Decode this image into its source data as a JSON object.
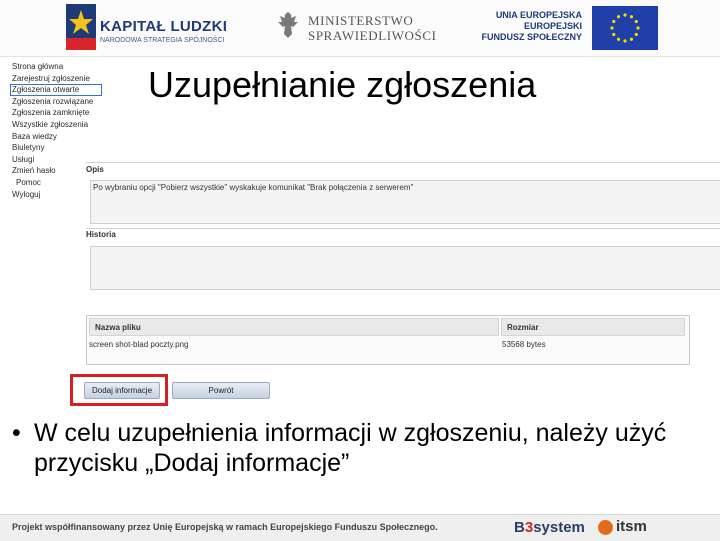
{
  "header": {
    "kapital_title": "KAPITAŁ LUDZKI",
    "kapital_sub": "NARODOWA STRATEGIA SPÓJNOŚCI",
    "ministry_line1": "MINISTERSTWO",
    "ministry_line2": "SPRAWIEDLIWOŚCI",
    "ue_line1": "UNIA EUROPEJSKA",
    "ue_line2": "EUROPEJSKI",
    "ue_line3": "FUNDUSZ SPOŁECZNY",
    "colors": {
      "kl_blue": "#1f3a78",
      "eu_blue": "#1e40a8",
      "eu_star": "#ffd400"
    }
  },
  "nav": {
    "items": [
      {
        "label": "Strona główna"
      },
      {
        "label": "Zarejestruj zgłoszenie"
      },
      {
        "label": "Zgłoszenia otwarte"
      },
      {
        "label": "Zgłoszenia rozwiązane"
      },
      {
        "label": "Zgłoszenia zamknięte"
      },
      {
        "label": "Wszystkie zgłoszenia"
      },
      {
        "label": "Baza wiedzy"
      },
      {
        "label": "Biuletyny"
      },
      {
        "label": "Usługi"
      },
      {
        "label": "Zmień hasło"
      },
      {
        "label": "Pomoc"
      },
      {
        "label": "Wyloguj"
      }
    ]
  },
  "slide": {
    "title": "Uzupełnianie zgłoszenia",
    "bullet": "W celu uzupełnienia informacji w zgłoszeniu, należy użyć przycisku „Dodaj informacje”"
  },
  "form": {
    "opis_label": "Opis",
    "opis_value": "Po wybraniu opcji \"Pobierz wszystkie\" wyskakuje komunikat \"Brak połączenia z serwerem\"",
    "historia_label": "Historia",
    "historia_value": ""
  },
  "files": {
    "headers": [
      "Nazwa pliku",
      "Rozmiar"
    ],
    "rows": [
      {
        "name": "screen shot-blad poczty.png",
        "size": "53568 bytes"
      }
    ]
  },
  "buttons": {
    "add_info": "Dodaj informacje",
    "back": "Powrót"
  },
  "footer": {
    "text": "Projekt współfinansowany przez Unię Europejską w ramach Europejskiego Funduszu Społecznego.",
    "b3_prefix": "B",
    "b3_three": "3",
    "b3_suffix": "system",
    "itsm": "itsm",
    "colors": {
      "b3_red": "#d4262a",
      "itsm_orange": "#e36b1c"
    }
  }
}
